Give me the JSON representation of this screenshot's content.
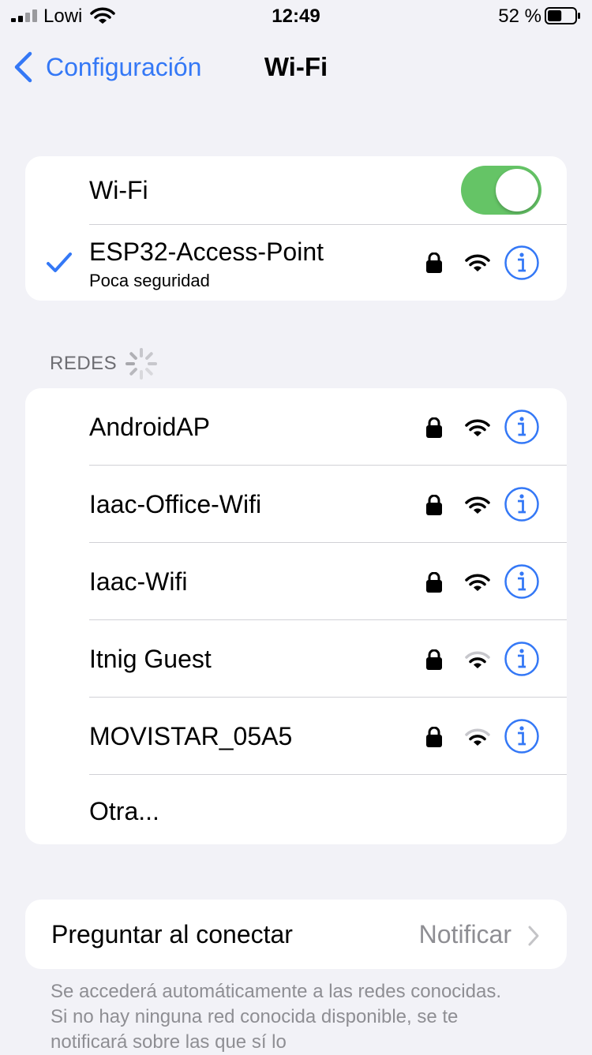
{
  "status_bar": {
    "carrier": "Lowi",
    "time": "12:49",
    "battery_percent": "52 %",
    "battery_level": 0.52
  },
  "nav": {
    "back_label": "Configuración",
    "title": "Wi-Fi"
  },
  "wifi_toggle": {
    "label": "Wi-Fi",
    "on": true
  },
  "connected": {
    "name": "ESP32-Access-Point",
    "subtitle": "Poca seguridad",
    "secured": true,
    "signal_bars": 3
  },
  "networks_section": {
    "title": "REDES"
  },
  "networks": [
    {
      "name": "AndroidAP",
      "secured": true,
      "signal_bars": 3
    },
    {
      "name": "Iaac-Office-Wifi",
      "secured": true,
      "signal_bars": 3
    },
    {
      "name": "Iaac-Wifi",
      "secured": true,
      "signal_bars": 3
    },
    {
      "name": "Itnig Guest",
      "secured": true,
      "signal_bars": 2
    },
    {
      "name": "MOVISTAR_05A5",
      "secured": true,
      "signal_bars": 2
    }
  ],
  "other_label": "Otra...",
  "ask_to_join": {
    "label": "Preguntar al conectar",
    "value": "Notificar"
  },
  "footer": "Se accederá automáticamente a las redes conocidas. Si no hay ninguna red conocida disponible, se te notificará sobre las que sí lo",
  "colors": {
    "accent": "#3478f6",
    "toggle_on": "#65c466",
    "background": "#f2f2f7"
  }
}
